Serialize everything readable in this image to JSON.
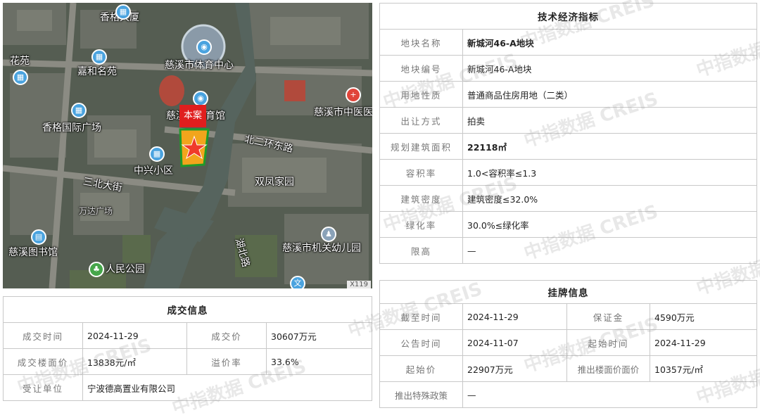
{
  "map": {
    "labels": {
      "xianggedasha": "香格大厦",
      "garden": "花苑",
      "jiahegardens": "嘉和名苑",
      "sports_center": "慈溪市体育中心",
      "sports_hall": "慈溪市体育馆",
      "hospital": "慈溪市中医医院",
      "plaza": "香格国际广场",
      "beierhuan": "北二环东路",
      "zhongxing": "中兴小区",
      "sanbei": "三北大街",
      "shuangfeng": "双凤家园",
      "library": "慈溪图书馆",
      "renmin_park": "人民公园",
      "kindergarten": "慈溪市机关幼儿园",
      "hubei": "湖北路",
      "wanda": "万达广场"
    },
    "marker_tag": "本案",
    "scale_label": "X119"
  },
  "tech": {
    "title": "技术经济指标",
    "rows": [
      {
        "label": "地块名称",
        "value": "新城河46-A地块"
      },
      {
        "label": "地块编号",
        "value": "新城河46-A地块"
      },
      {
        "label": "用地性质",
        "value": "普通商品住房用地（二类）"
      },
      {
        "label": "出让方式",
        "value": "拍卖"
      },
      {
        "label": "规划建筑面积",
        "value": "22118㎡"
      },
      {
        "label": "容积率",
        "value": "1.0<容积率≤1.3"
      },
      {
        "label": "建筑密度",
        "value": "建筑密度≤32.0%"
      },
      {
        "label": "绿化率",
        "value": "30.0%≤绿化率"
      },
      {
        "label": "限高",
        "value": "—"
      }
    ]
  },
  "deal": {
    "title": "成交信息",
    "time_label": "成交时间",
    "time_value": "2024-11-29",
    "price_label": "成交价",
    "price_value": "30607万元",
    "floor_label": "成交楼面价",
    "floor_value": "13838元/㎡",
    "premium_label": "溢价率",
    "premium_value": "33.6%",
    "buyer_label": "受让单位",
    "buyer_value": "宁波德高置业有限公司"
  },
  "listing": {
    "title": "挂牌信息",
    "deadline_label": "截至时间",
    "deadline_value": "2024-11-29",
    "deposit_label": "保证金",
    "deposit_value": "4590万元",
    "announce_label": "公告时间",
    "announce_value": "2024-11-07",
    "start_time_label": "起始时间",
    "start_time_value": "2024-11-29",
    "start_price_label": "起始价",
    "start_price_value": "22907万元",
    "start_floor_label": "推出楼面价面价",
    "start_floor_value": "10357元/㎡",
    "policy_label": "推出特殊政策",
    "policy_value": "—"
  },
  "watermark": "中指数据 CREIS",
  "colors": {
    "marker": "#e01e1e",
    "plot": "#f2a51c",
    "plot_border": "#1f9a2a",
    "water": "#5d6a63"
  }
}
